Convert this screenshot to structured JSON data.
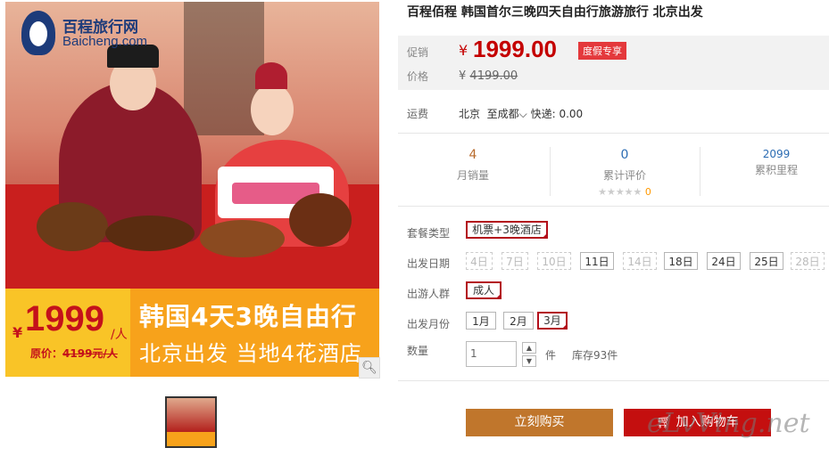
{
  "gallery": {
    "logo_name": "百程旅行网",
    "logo_domain": "Baicheng.com",
    "banner_yen": "¥",
    "banner_price": "1999",
    "banner_per": "/人",
    "banner_orig_label": "原价：",
    "banner_orig_value": "4199元/人",
    "banner_title": "韩国4天3晚自由行",
    "banner_subtitle": "北京出发 当地4花酒店",
    "zoom_icon": "search-icon"
  },
  "product": {
    "title": "百程佰程 韩国首尔三晚四天自由行旅游旅行 北京出发",
    "promo_label": "促销",
    "price_label": "价格",
    "currency": "¥",
    "current_price": "1999.00",
    "promo_tag": "度假专享",
    "original_price": "4199.00"
  },
  "shipping": {
    "label": "运费",
    "from": "北京",
    "to": "至成都",
    "method": "快递: 0.00"
  },
  "stats": {
    "monthly_sales": {
      "value": "4",
      "label": "月销量"
    },
    "reviews": {
      "value": "0",
      "label": "累计评价",
      "stars": "★★★★★",
      "score": "0"
    },
    "points": {
      "value": "2099",
      "label": "累积里程"
    }
  },
  "options": {
    "package_label": "套餐类型",
    "package_value": "机票+3晚酒店",
    "date_label": "出发日期",
    "dates": [
      "4日",
      "7日",
      "10日",
      "11日",
      "14日",
      "18日",
      "24日",
      "25日",
      "28日"
    ],
    "crowd_label": "出游人群",
    "crowd_value": "成人",
    "month_label": "出发月份",
    "months": [
      "1月",
      "2月",
      "3月"
    ]
  },
  "quantity": {
    "label": "数量",
    "value": "1",
    "unit": "件",
    "stock": "库存93件"
  },
  "actions": {
    "buy": "立刻购买",
    "cart": "加入购物车"
  },
  "watermark": "eLvVing.net"
}
